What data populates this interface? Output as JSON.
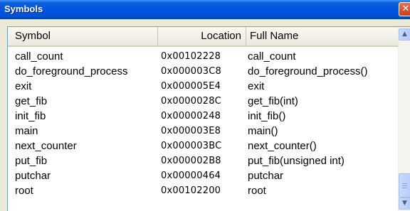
{
  "window": {
    "title": "Symbols",
    "close_glyph": "✕"
  },
  "table": {
    "columns": [
      "Symbol",
      "Location",
      "Full Name"
    ],
    "rows": [
      {
        "symbol": "call_count",
        "location": "0x00102228",
        "full_name": "call_count"
      },
      {
        "symbol": "do_foreground_process",
        "location": "0x000003C8",
        "full_name": "do_foreground_process()"
      },
      {
        "symbol": "exit",
        "location": "0x000005E4",
        "full_name": "exit"
      },
      {
        "symbol": "get_fib",
        "location": "0x0000028C",
        "full_name": "get_fib(int)"
      },
      {
        "symbol": "init_fib",
        "location": "0x00000248",
        "full_name": "init_fib()"
      },
      {
        "symbol": "main",
        "location": "0x000003E8",
        "full_name": "main()"
      },
      {
        "symbol": "next_counter",
        "location": "0x000003BC",
        "full_name": "next_counter()"
      },
      {
        "symbol": "put_fib",
        "location": "0x000002B8",
        "full_name": "put_fib(unsigned int)"
      },
      {
        "symbol": "putchar",
        "location": "0x00000464",
        "full_name": "putchar"
      },
      {
        "symbol": "root",
        "location": "0x00102200",
        "full_name": "root"
      }
    ]
  },
  "scrollbar": {
    "up_icon": "chevron-up-icon",
    "down_icon": "chevron-down-icon",
    "up_glyph": "▲",
    "down_glyph": "▼"
  }
}
